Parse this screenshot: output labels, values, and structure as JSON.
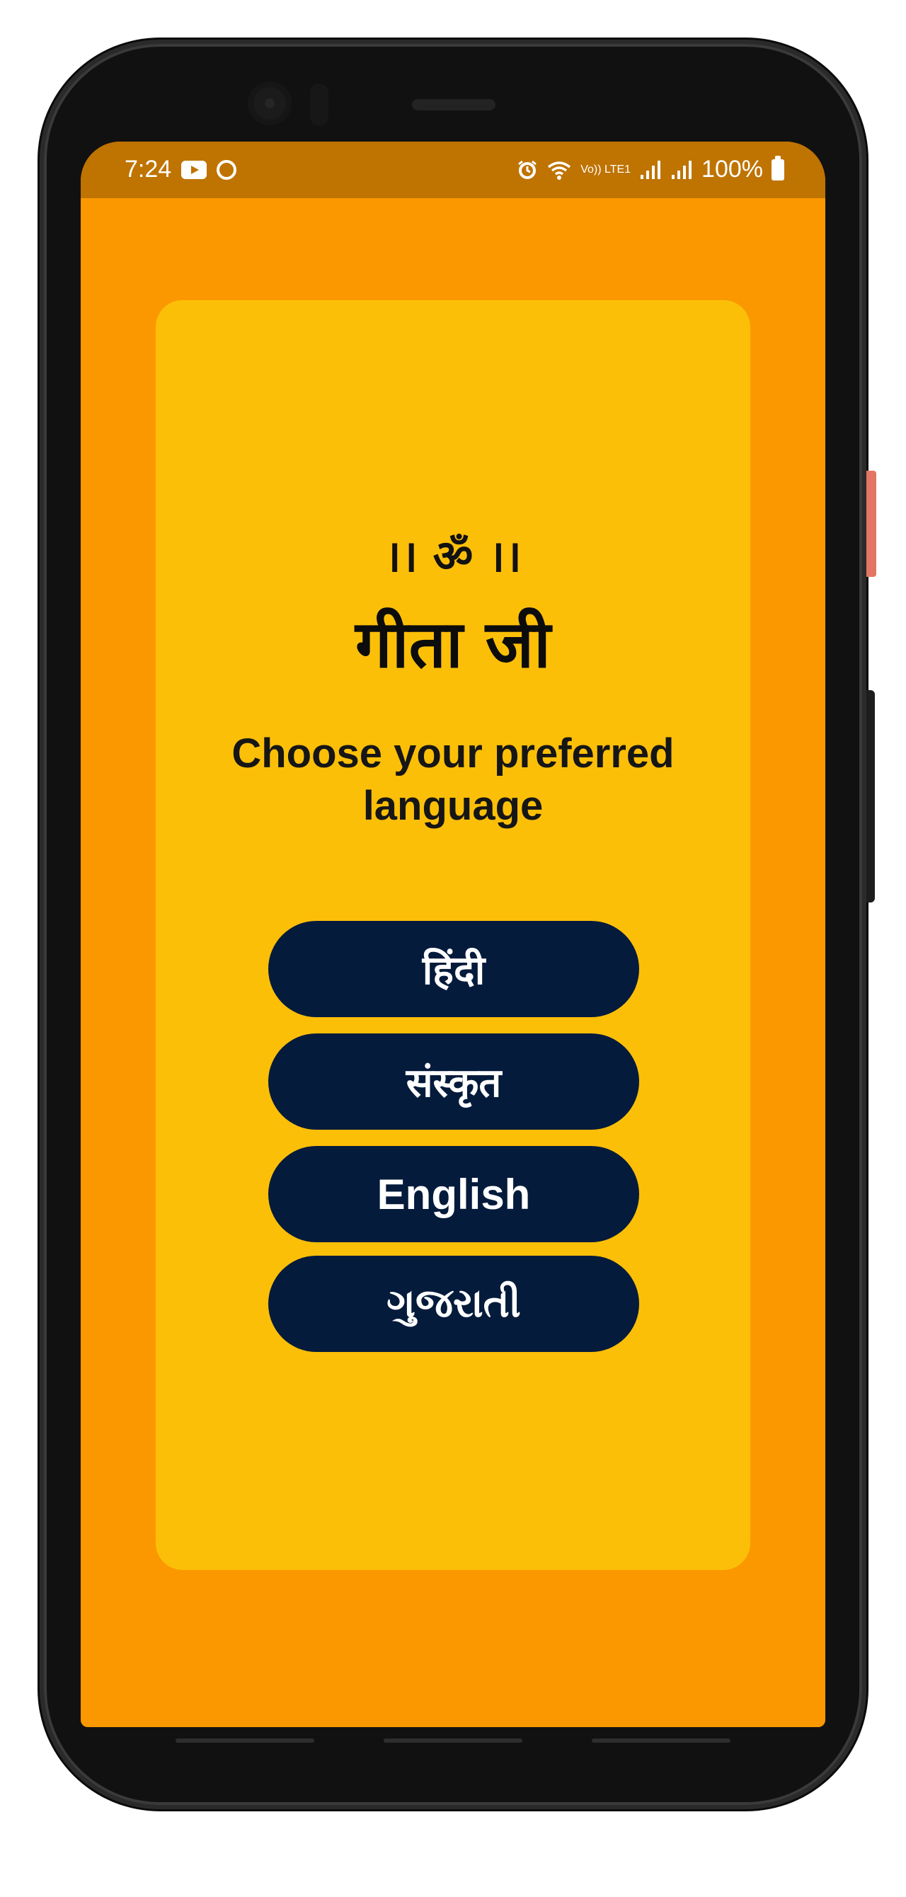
{
  "status_bar": {
    "time": "7:24",
    "network_label": "Vo)) LTE1",
    "battery_text": "100%",
    "icons": [
      "youtube-icon",
      "sync-icon",
      "alarm-icon",
      "wifi-icon",
      "signal-icon",
      "signal-icon",
      "battery-icon"
    ]
  },
  "card": {
    "om_line": "।। ॐ ।।",
    "title": "गीता जी",
    "prompt": "Choose your preferred language"
  },
  "languages": [
    {
      "label": "हिंदी"
    },
    {
      "label": "संस्कृत"
    },
    {
      "label": "English"
    },
    {
      "label": "ગુજરાતી"
    }
  ],
  "colors": {
    "background": "#fb9800",
    "status_bar": "#bf7300",
    "card": "#fcbf08",
    "button": "#041b3c",
    "button_text": "#ffffff"
  }
}
